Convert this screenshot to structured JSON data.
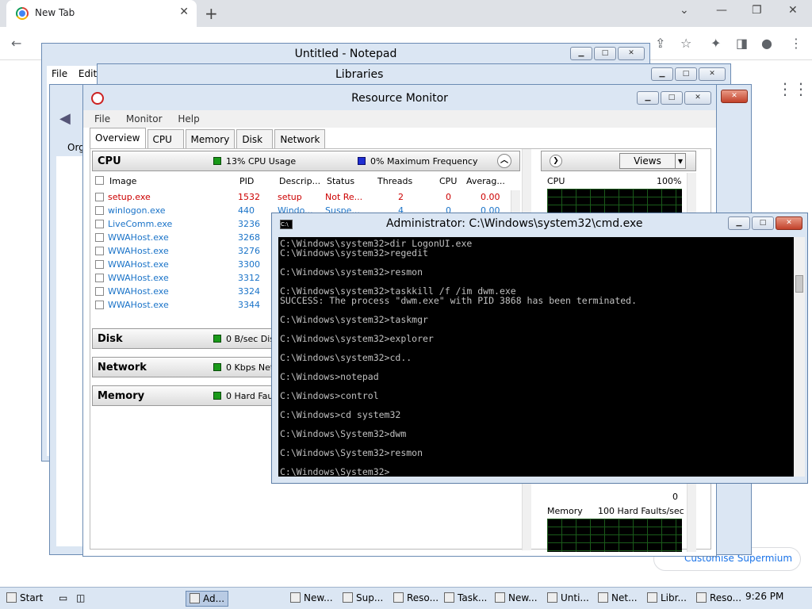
{
  "chrome": {
    "tab_title": "New Tab",
    "tab_close": "✕",
    "new_tab": "+",
    "customise_label": "Customise Supermium"
  },
  "notepad": {
    "title": "Untitled - Notepad",
    "menu": [
      "File",
      "Edit"
    ]
  },
  "libraries": {
    "title": "Libraries",
    "org_label": "Org"
  },
  "resmon": {
    "title": "Resource Monitor",
    "menu": [
      "File",
      "Monitor",
      "Help"
    ],
    "tabs": [
      "Overview",
      "CPU",
      "Memory",
      "Disk",
      "Network"
    ],
    "cpu_section": {
      "title": "CPU",
      "usage": "13% CPU Usage",
      "freq": "0% Maximum Frequency"
    },
    "columns": [
      "Image",
      "PID",
      "Descrip...",
      "Status",
      "Threads",
      "CPU",
      "Averag..."
    ],
    "rows": [
      {
        "image": "setup.exe",
        "pid": "1532",
        "desc": "setup",
        "status": "Not Re...",
        "threads": "2",
        "cpu": "0",
        "avg": "0.00"
      },
      {
        "image": "winlogon.exe",
        "pid": "440",
        "desc": "Windo...",
        "status": "Suspe...",
        "threads": "4",
        "cpu": "0",
        "avg": "0.00"
      },
      {
        "image": "LiveComm.exe",
        "pid": "3236",
        "desc": "",
        "status": "",
        "threads": "",
        "cpu": "",
        "avg": ""
      },
      {
        "image": "WWAHost.exe",
        "pid": "3268",
        "desc": "",
        "status": "",
        "threads": "",
        "cpu": "",
        "avg": ""
      },
      {
        "image": "WWAHost.exe",
        "pid": "3276",
        "desc": "",
        "status": "",
        "threads": "",
        "cpu": "",
        "avg": ""
      },
      {
        "image": "WWAHost.exe",
        "pid": "3300",
        "desc": "",
        "status": "",
        "threads": "",
        "cpu": "",
        "avg": ""
      },
      {
        "image": "WWAHost.exe",
        "pid": "3312",
        "desc": "",
        "status": "",
        "threads": "",
        "cpu": "",
        "avg": ""
      },
      {
        "image": "WWAHost.exe",
        "pid": "3324",
        "desc": "",
        "status": "",
        "threads": "",
        "cpu": "",
        "avg": ""
      },
      {
        "image": "WWAHost.exe",
        "pid": "3344",
        "desc": "",
        "status": "",
        "threads": "",
        "cpu": "",
        "avg": ""
      }
    ],
    "disk": {
      "title": "Disk",
      "stat": "0 B/sec Disk"
    },
    "network": {
      "title": "Network",
      "stat": "0 Kbps Netw"
    },
    "memory": {
      "title": "Memory",
      "stat": "0 Hard Fault"
    },
    "views_label": "Views",
    "graph_cpu_label": "CPU",
    "graph_cpu_max": "100%",
    "graph_mem_label": "Memory",
    "graph_mem_stat": "100 Hard Faults/sec",
    "graph_zero": "0"
  },
  "cmd": {
    "title": "Administrator: C:\\Windows\\system32\\cmd.exe",
    "icon_text": "C:\\",
    "lines": [
      "C:\\Windows\\system32>dir LogonUI.exe",
      "C:\\Windows\\system32>regedit",
      "",
      "C:\\Windows\\system32>resmon",
      "",
      "C:\\Windows\\system32>taskkill /f /im dwm.exe",
      "SUCCESS: The process \"dwm.exe\" with PID 3868 has been terminated.",
      "",
      "C:\\Windows\\system32>taskmgr",
      "",
      "C:\\Windows\\system32>explorer",
      "",
      "C:\\Windows\\system32>cd..",
      "",
      "C:\\Windows>notepad",
      "",
      "C:\\Windows>control",
      "",
      "C:\\Windows>cd system32",
      "",
      "C:\\Windows\\System32>dwm",
      "",
      "C:\\Windows\\System32>resmon",
      "",
      "C:\\Windows\\System32>_"
    ]
  },
  "taskbar": {
    "start": "Start",
    "items": [
      "Ad...",
      "New...",
      "Sup...",
      "Reso...",
      "Task...",
      "New...",
      "Unti...",
      "Net...",
      "Libr...",
      "Reso..."
    ],
    "clock": "9:26 PM"
  }
}
